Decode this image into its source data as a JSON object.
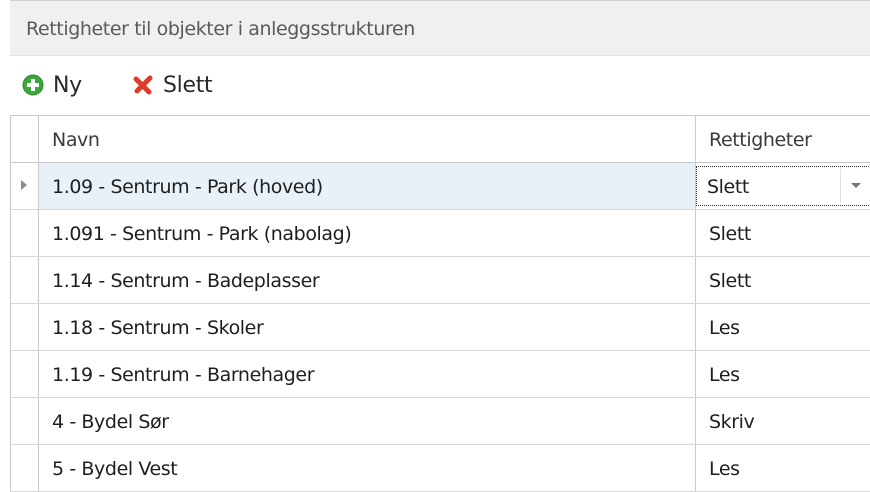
{
  "panel": {
    "title": "Rettigheter til objekter i anleggsstrukturen"
  },
  "toolbar": {
    "new_label": "Ny",
    "delete_label": "Slett",
    "new_icon": "add-icon",
    "delete_icon": "delete-icon",
    "new_icon_color": "#3aa83a",
    "delete_icon_color": "#e03a2a"
  },
  "grid": {
    "columns": [
      "Navn",
      "Rettigheter"
    ],
    "rows": [
      {
        "name": "1.09 - Sentrum - Park (hoved)",
        "rights": "Slett"
      },
      {
        "name": "1.091 - Sentrum - Park (nabolag)",
        "rights": "Slett"
      },
      {
        "name": "1.14 - Sentrum - Badeplasser",
        "rights": "Slett"
      },
      {
        "name": "1.18 - Sentrum - Skoler",
        "rights": "Les"
      },
      {
        "name": "1.19 - Sentrum - Barnehager",
        "rights": "Les"
      },
      {
        "name": "4 - Bydel Sør",
        "rights": "Skriv"
      },
      {
        "name": "5 - Bydel Vest",
        "rights": "Les"
      }
    ],
    "selected_row": 0,
    "selection_color": "#e8f0f8"
  }
}
